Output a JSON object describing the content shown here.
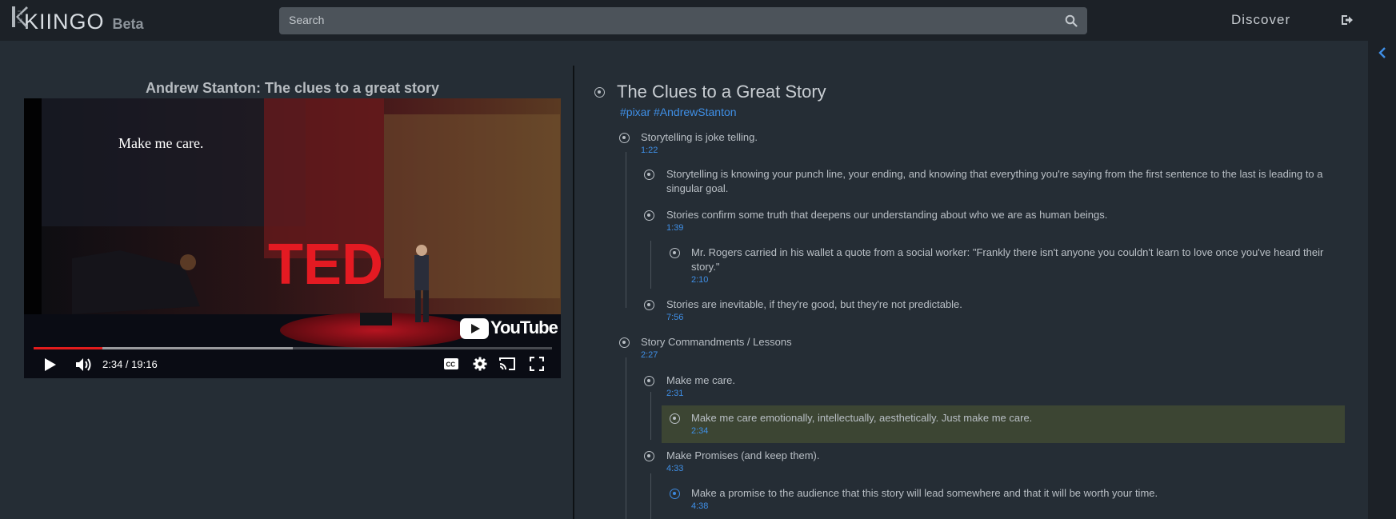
{
  "app": {
    "logo": "KIINGO",
    "beta": "Beta"
  },
  "search": {
    "placeholder": "Search"
  },
  "nav": {
    "discover": "Discover"
  },
  "video": {
    "title": "Andrew Stanton: The clues to a great story",
    "caption": "Make me care.",
    "stage_sign": "TED",
    "brand": "YouTube",
    "time": "2:34 / 19:16",
    "progress": 0.133,
    "buffered": 0.5
  },
  "outline": {
    "title": "The Clues to a Great Story",
    "tags": "#pixar #AndrewStanton",
    "nodes": [
      {
        "text": "Storytelling is joke telling.",
        "time": "1:22"
      },
      {
        "text": "Storytelling is knowing your punch line, your ending, and knowing that everything you're saying from the first sentence to the last is leading to a singular goal.",
        "time": ""
      },
      {
        "text": "Stories confirm some truth that deepens our understanding about who we are as human beings.",
        "time": "1:39"
      },
      {
        "text": "Mr. Rogers carried in his wallet a quote from a social worker: \"Frankly there isn't anyone you couldn't learn to love once you've heard their story.\"",
        "time": "2:10"
      },
      {
        "text": "Stories are inevitable, if they're good, but they're not predictable.",
        "time": "7:56"
      },
      {
        "text": "Story Commandments / Lessons",
        "time": "2:27"
      },
      {
        "text": "Make me care.",
        "time": "2:31"
      },
      {
        "text": "Make me care emotionally, intellectually, aesthetically. Just make me care.",
        "time": "2:34"
      },
      {
        "text": "Make Promises (and keep them).",
        "time": "4:33"
      },
      {
        "text": "Make a promise to the audience that this story will lead somewhere and that it will be worth your time.",
        "time": "4:38"
      }
    ]
  },
  "colors": {
    "accent": "#3f8fe6",
    "highlight": "#3c4533",
    "background": "#252d35",
    "topbar": "#1c2127"
  }
}
